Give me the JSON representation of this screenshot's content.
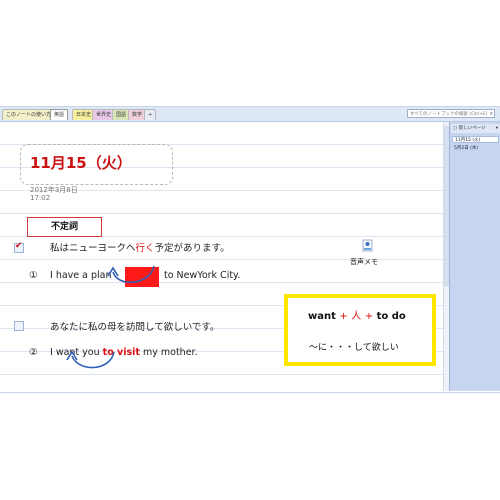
{
  "tabs": [
    {
      "label": "このノートの使い方",
      "color": "#f2f0c8"
    },
    {
      "label": "英語",
      "color": "#ffffff"
    },
    {
      "label": "日本史",
      "color": "#f6ef9c"
    },
    {
      "label": "世界史",
      "color": "#e9c9e8"
    },
    {
      "label": "国語",
      "color": "#d9e6b8"
    },
    {
      "label": "数学",
      "color": "#f0d0dc"
    },
    {
      "label": "+",
      "color": "#e6ecf5"
    }
  ],
  "search": {
    "placeholder": "すべてのノートブックの検索 (Ctrl+E)"
  },
  "pane": {
    "new_page": "新しいページ",
    "items": [
      {
        "label": "11月15 (火)",
        "selected": true
      },
      {
        "label": "5月2日 (木)",
        "selected": false
      }
    ]
  },
  "page": {
    "title": "11月15（火）",
    "date": "2012年3月8日",
    "time": "17:02",
    "label": "不定詞",
    "item1": {
      "jp_before": "私はニューヨークへ",
      "jp_highlight": "行く",
      "jp_after": "予定があります。",
      "num": "①",
      "en_before": "I have a plan",
      "en_after": "to NewYork City."
    },
    "item2": {
      "jp": "あなたに私の母を訪問して欲しいです。",
      "num": "②",
      "en_before": "I want you",
      "en_highlight": "to visit",
      "en_after": "my mother."
    },
    "audio_label": "音声メモ",
    "grammar": {
      "want": "want",
      "plus1": "+",
      "person": "人",
      "plus2": "+",
      "todo": "to do",
      "meaning": "～に・・・して欲しい"
    }
  }
}
